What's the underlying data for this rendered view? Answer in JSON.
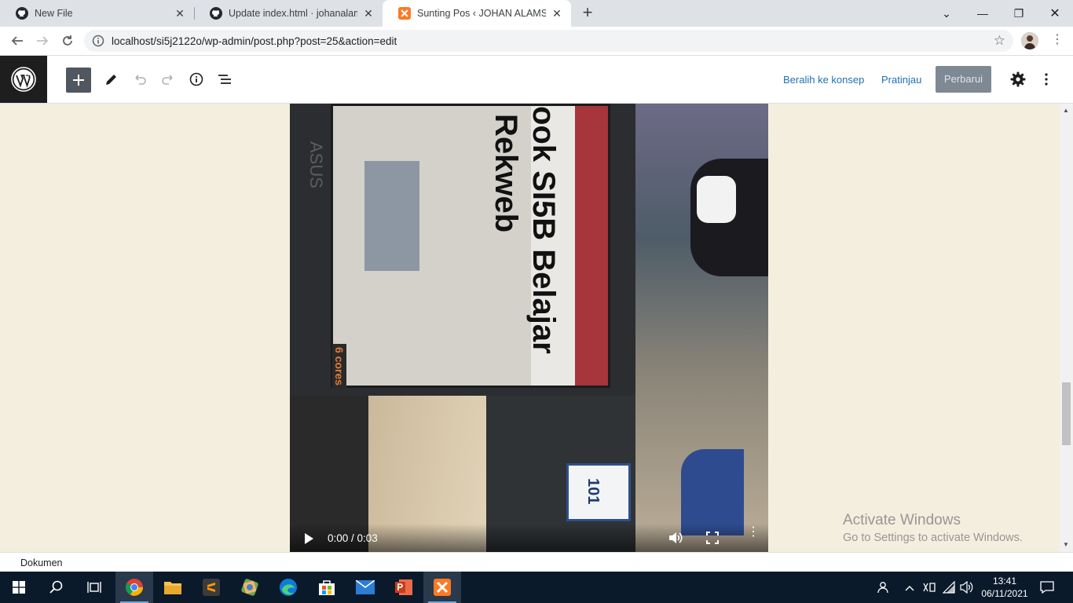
{
  "browser": {
    "tabs": [
      {
        "label": "New File",
        "icon": "github-icon",
        "active": false
      },
      {
        "label": "Update index.html · johanalamsyah",
        "icon": "github-icon",
        "active": false
      },
      {
        "label": "Sunting Pos ‹ JOHAN ALAMSYAH",
        "icon": "xampp-icon",
        "active": true
      }
    ],
    "new_tab": "+",
    "url": "localhost/si5j2122o/wp-admin/post.php?post=25&action=edit"
  },
  "editor": {
    "switch_to_draft": "Beralih ke konsep",
    "preview": "Pratinjau",
    "update": "Perbarui",
    "breadcrumb": "Dokumen",
    "accent": "#2271b1"
  },
  "video": {
    "time": "0:00 / 0:03",
    "caption_line1": "ook SI5B Belajar",
    "caption_line2": "Rekweb",
    "brand": "ASUS",
    "sticker": "6 cores",
    "card_number": "101"
  },
  "watermark": {
    "title": "Activate Windows",
    "subtitle": "Go to Settings to activate Windows."
  },
  "taskbar": {
    "time": "13:41",
    "date": "06/11/2021"
  }
}
